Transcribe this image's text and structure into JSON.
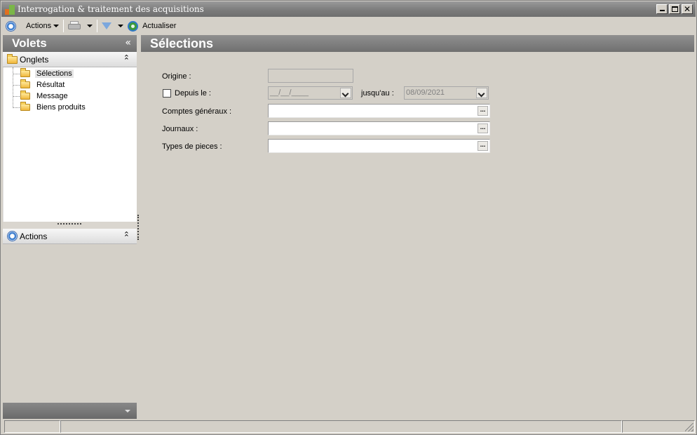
{
  "window": {
    "title": "Interrogation & traitement des acquisitions"
  },
  "toolbar": {
    "actions_label": "Actions",
    "refresh_label": "Actualiser"
  },
  "left_pane": {
    "title": "Volets",
    "collapse_glyph": "«",
    "tabs_group": {
      "label": "Onglets",
      "items": [
        {
          "label": "Sélections",
          "selected": true
        },
        {
          "label": "Résultat"
        },
        {
          "label": "Message"
        },
        {
          "label": "Biens produits"
        }
      ]
    },
    "actions_group": {
      "label": "Actions"
    }
  },
  "main": {
    "title": "Sélections",
    "form": {
      "origine_label": "Origine :",
      "origine_value": "",
      "depuis_label": "Depuis le :",
      "depuis_checked": false,
      "depuis_value": "__/__/____",
      "jusquau_label": "jusqu'au :",
      "jusquau_value": "08/09/2021",
      "comptes_label": "Comptes généraux :",
      "journaux_label": "Journaux :",
      "types_label": "Types de pieces :",
      "ellipsis": "..."
    }
  },
  "icons": [
    "app-icon",
    "actions-icon",
    "printer-icon",
    "filter-icon",
    "refresh-icon",
    "folder-icon",
    "chevron-up-icon"
  ]
}
